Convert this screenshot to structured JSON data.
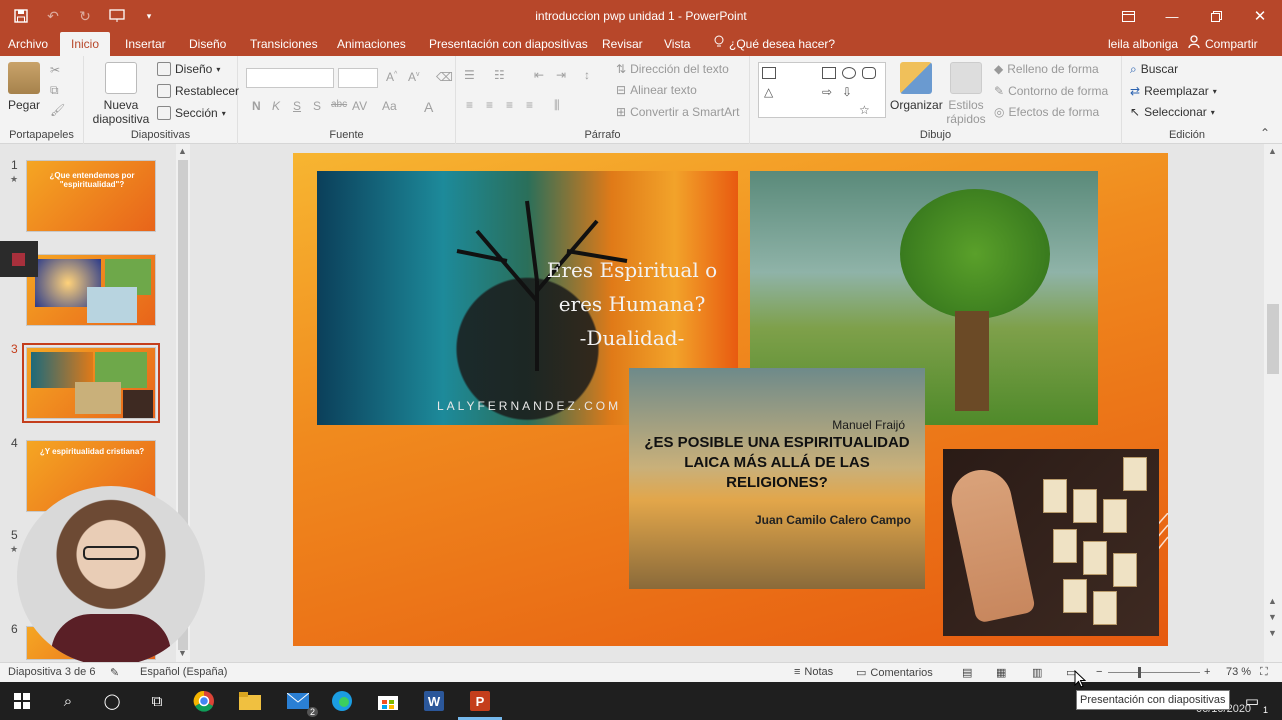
{
  "window": {
    "title": "introduccion pwp unidad 1 - PowerPoint",
    "brand_color": "#b7472a",
    "controls": [
      "ribbon-display-icon",
      "minimize-icon",
      "restore-icon",
      "close-icon"
    ]
  },
  "qat": [
    "save-icon",
    "undo-icon",
    "redo-icon",
    "start-presentation-icon",
    "customize-icon"
  ],
  "tabs": [
    {
      "label": "Archivo",
      "active": false
    },
    {
      "label": "Inicio",
      "active": true
    },
    {
      "label": "Insertar",
      "active": false
    },
    {
      "label": "Diseño",
      "active": false
    },
    {
      "label": "Transiciones",
      "active": false
    },
    {
      "label": "Animaciones",
      "active": false
    },
    {
      "label": "Presentación con diapositivas",
      "active": false
    },
    {
      "label": "Revisar",
      "active": false
    },
    {
      "label": "Vista",
      "active": false
    }
  ],
  "tell_me": "¿Qué desea hacer?",
  "user_name": "leila alboniga",
  "share_label": "Compartir",
  "ribbon": {
    "portapapeles": {
      "label": "Portapapeles",
      "paste": "Pegar"
    },
    "diapositivas": {
      "label": "Diapositivas",
      "new_slide": "Nueva diapositiva",
      "layout": "Diseño",
      "reset": "Restablecer",
      "section": "Sección"
    },
    "fuente": {
      "label": "Fuente",
      "bold": "N",
      "italic": "K",
      "underline": "S",
      "shadow": "S",
      "strike": "abc",
      "spacing": "AV",
      "case": "Aa",
      "color": "A"
    },
    "parrafo": {
      "label": "Párrafo",
      "text_direction": "Dirección del texto",
      "align_text": "Alinear texto",
      "smartart": "Convertir a SmartArt"
    },
    "dibujo": {
      "label": "Dibujo",
      "arrange": "Organizar",
      "quick_styles": "Estilos rápidos",
      "fill": "Relleno de forma",
      "outline": "Contorno de forma",
      "effects": "Efectos de forma"
    },
    "edicion": {
      "label": "Edición",
      "find": "Buscar",
      "replace": "Reemplazar",
      "select": "Seleccionar"
    }
  },
  "thumbnails": [
    {
      "num": "1",
      "title": "¿Que entendemos por \"espiritualidad\"?",
      "star": true,
      "selected": false
    },
    {
      "num": "2",
      "title": "",
      "star": false,
      "selected": false
    },
    {
      "num": "3",
      "title": "",
      "star": false,
      "selected": true
    },
    {
      "num": "4",
      "title": "¿Y espiritualidad cristiana?",
      "star": false,
      "selected": false
    },
    {
      "num": "5",
      "title": "",
      "star": true,
      "selected": false
    },
    {
      "num": "6",
      "title": "",
      "star": false,
      "selected": false
    }
  ],
  "slide": {
    "image1": {
      "text_lines": [
        "Eres Espiritual o",
        "eres Humana?",
        "-Dualidad-"
      ],
      "credit": "LALYFERNANDEZ.COM"
    },
    "image3": {
      "author": "Manuel Fraijó",
      "title": "¿ES POSIBLE UNA ESPIRITUALIDAD LAICA MÁS ALLÁ DE LAS RELIGIONES?",
      "subtitle": "Juan Camilo Calero Campo"
    }
  },
  "status": {
    "slide_count": "Diapositiva 3 de 6",
    "language": "Español (España)",
    "notes": "Notas",
    "comments": "Comentarios",
    "zoom": "73 %",
    "zoom_fraction": 0.73
  },
  "taskbar": [
    "windows-icon",
    "search-icon",
    "cortana-icon",
    "task-view-icon",
    "chrome-icon",
    "file-explorer-icon",
    "mail-icon",
    "edge-icon",
    "store-icon",
    "word-icon",
    "powerpoint-icon"
  ],
  "clock": {
    "date": "06/10/2020"
  },
  "mail_badge": "2",
  "notification_badge": "1",
  "tooltip": "Presentación con diapositivas"
}
